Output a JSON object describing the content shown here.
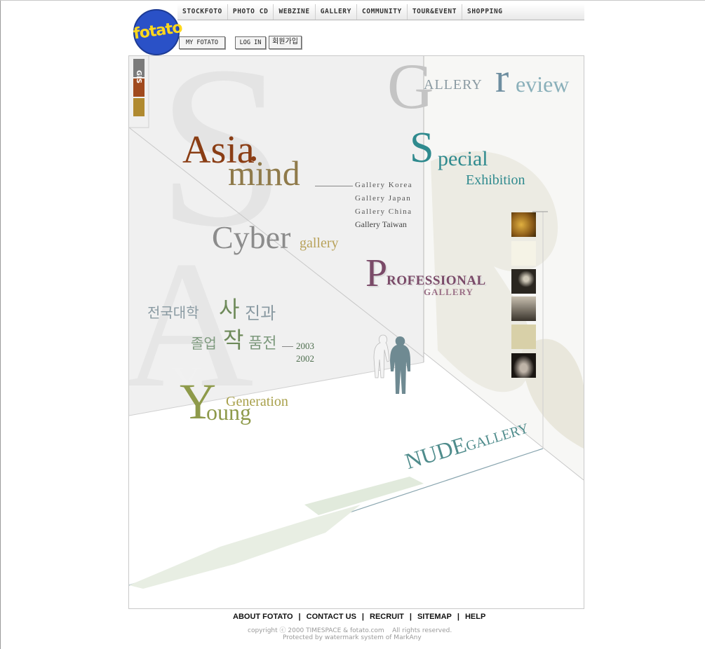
{
  "logo": {
    "text": "fotato"
  },
  "nav": [
    "STOCKFOTO",
    "PHOTO CD",
    "WEBZINE",
    "GALLERY",
    "COMMUNITY",
    "TOUR&EVENT",
    "SHOPPING"
  ],
  "buttons": {
    "myfotato": "MY FOTATO",
    "login": "LOG IN",
    "join": "회원가입"
  },
  "side_tab": "GIS",
  "gallery": {
    "review_big_g": "G",
    "review_allery": "ALLERY",
    "review_r": "r",
    "review_eview": "eview",
    "asia": "Asia",
    "mind": "mind",
    "links": [
      "Gallery Korea",
      "Gallery Japan",
      "Gallery China",
      "Gallery Taiwan"
    ],
    "special_s": "S",
    "special_rest": "pecial",
    "exhibition": "Exhibition",
    "cyber": "Cyber",
    "cyber_gallery": "gallery",
    "prof_p": "P",
    "prof_rest": "ROFESSIONAL",
    "prof_gallery": "GALLERY",
    "univ_line1_a": "전국대학",
    "univ_line1_b": "사",
    "univ_line1_c": "진과",
    "univ_line2_a": "졸업",
    "univ_line2_b": "작",
    "univ_line2_c": "품전",
    "year1": "2003",
    "year2": "2002",
    "young_y": "Y",
    "young_rest": "oung",
    "generation": "Generation",
    "nude": "NUDE",
    "nude_gallery": "GALLERY"
  },
  "footer": {
    "links": [
      "ABOUT FOTATO",
      "CONTACT US",
      "RECRUIT",
      "SITEMAP",
      "HELP"
    ],
    "sep": "|",
    "copyright": "copyright ⓒ 2000 TIMESPACE & fotato.com    All rights reserved.",
    "protected": "Protected by watermark system of MarkAny"
  },
  "colors": {
    "asia": "#8a3d14",
    "mind": "#8f7a4a",
    "teal": "#2f8a8e",
    "professional": "#7a4a68",
    "korean": "#8a9aa2",
    "korean_accent": "#6e8a5a",
    "young": "#8e9a4a",
    "review": "#6e8ea0",
    "nude": "#4f8c8c"
  }
}
